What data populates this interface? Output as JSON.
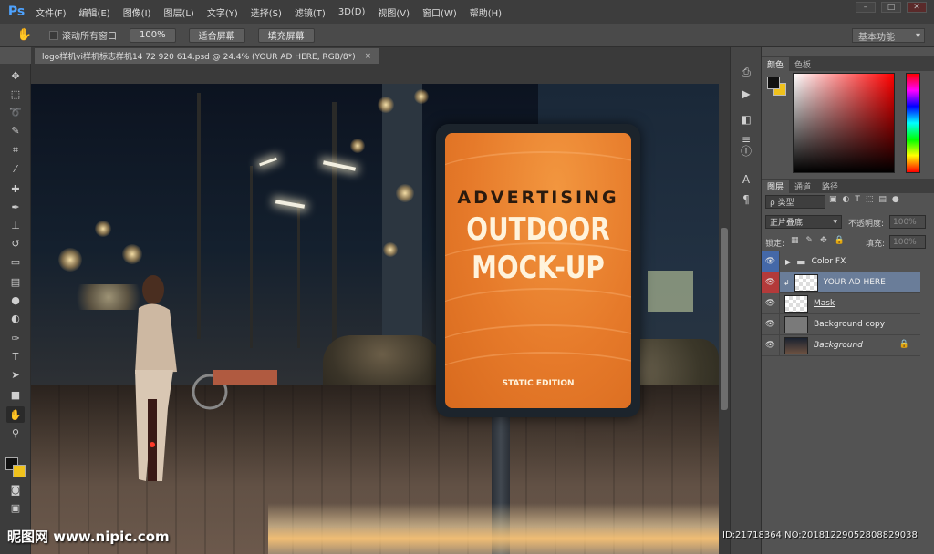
{
  "app": {
    "logo": "Ps"
  },
  "menu": [
    "文件(F)",
    "编辑(E)",
    "图像(I)",
    "图层(L)",
    "文字(Y)",
    "选择(S)",
    "滤镜(T)",
    "3D(D)",
    "视图(V)",
    "窗口(W)",
    "帮助(H)"
  ],
  "options": {
    "scroll_all_label": "滚动所有窗口",
    "zoom_100": "100%",
    "fit_screen": "适合屏幕",
    "fill_screen": "填充屏幕",
    "workspace": "基本功能"
  },
  "document": {
    "tab_title": "logo样机vi样机标志样机14 72 920 614.psd @ 24.4% (YOUR AD HERE, RGB/8*)",
    "tab_close": "×"
  },
  "poster": {
    "line1": "ADVERTISING",
    "line2": "OUTDOOR",
    "line3": "MOCK-UP",
    "edition": "STATIC EDITION"
  },
  "color_panel": {
    "tabs": [
      "颜色",
      "色板"
    ]
  },
  "layers_panel": {
    "tabs": [
      "图层",
      "通道",
      "路径"
    ],
    "filter": "ρ 类型",
    "blend_mode": "正片叠底",
    "opacity_label": "不透明度:",
    "opacity_value": "100%",
    "lock_label": "锁定:",
    "fill_label": "填充:",
    "fill_value": "100%",
    "layers": [
      {
        "name": "Color FX",
        "type": "group"
      },
      {
        "name": "YOUR AD HERE",
        "type": "smart",
        "selected": true
      },
      {
        "name": "Mask",
        "type": "pixel"
      },
      {
        "name": "Background copy",
        "type": "pixel"
      },
      {
        "name": "Background",
        "type": "background",
        "locked": true
      }
    ]
  },
  "watermark": {
    "left": "昵图网 www.nipic.com",
    "right": "ID:21718364 NO:20181229052808829038"
  },
  "colors": {
    "foreground": "#111111",
    "background": "#f0c21c",
    "poster_orange": "#e67a2a"
  }
}
